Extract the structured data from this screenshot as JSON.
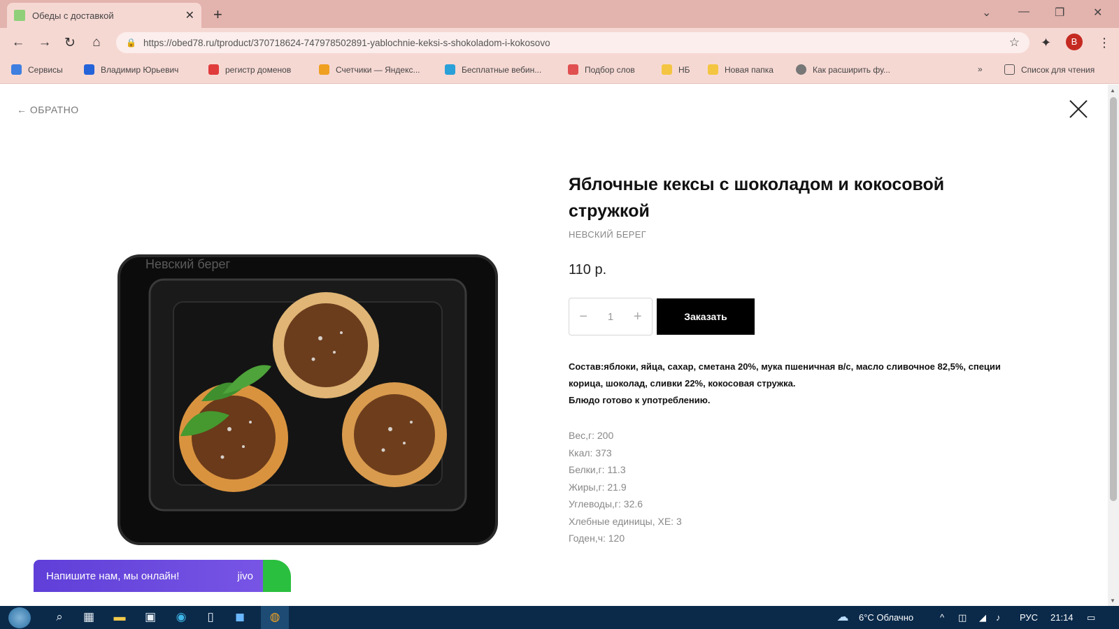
{
  "browser": {
    "tab_title": "Обеды с доставкой",
    "tab_close": "✕",
    "new_tab": "+",
    "url": "https://obed78.ru/tproduct/370718624-747978502891-yablochnie-keksi-s-shokoladom-i-kokosovo",
    "bookmarks": [
      {
        "label": "Сервисы",
        "color": "#3f7fe0"
      },
      {
        "label": "Владимир Юрьевич",
        "color": "#2563d9"
      },
      {
        "label": "регистр доменов",
        "color": "#e03c3c"
      },
      {
        "label": "Счетчики — Яндекс...",
        "color": "#f0a020"
      },
      {
        "label": "Бесплатные вебин...",
        "color": "#2aa0d8"
      },
      {
        "label": "Подбор слов",
        "color": "#e05050"
      },
      {
        "label": "НБ",
        "color": "#f4c542"
      },
      {
        "label": "Новая папка",
        "color": "#f4c542"
      },
      {
        "label": "Как расширить фу...",
        "color": "#777777"
      }
    ],
    "more_bookmarks": "»",
    "reading_list": "Список для чтения",
    "profile_initial": "В"
  },
  "page": {
    "back_label": "← ОБРАТНО",
    "title": "Яблочные кексы с шоколадом и кокосовой стружкой",
    "brand": "НЕВСКИЙ БЕРЕГ",
    "price": "110 р.",
    "quantity": {
      "minus": "−",
      "value": "1",
      "plus": "+"
    },
    "order_button": "Заказать",
    "description_lines": [
      "Состав:яблоки, яйца, сахар, сметана 20%, мука пшеничная в/с, масло сливочное 82,5%, специи корица, шоколад, сливки 22%, кокосовая стружка.",
      "Блюдо готово к употреблению."
    ],
    "nutrition": [
      "Вес,г: 200",
      "Ккал: 373",
      "Белки,г: 11.3",
      "Жиры,г: 21.9",
      "Углеводы,г: 32.6",
      "Хлебные единицы, ХЕ: 3",
      "Годен,ч: 120"
    ],
    "image_watermark": "Невский берег"
  },
  "chat": {
    "label": "Напишите нам, мы онлайн!",
    "brand": "jivo"
  },
  "taskbar": {
    "weather": "6°C  Облачно",
    "language": "РУС",
    "time": "21:14"
  },
  "colors": {
    "chrome": "#e3b3ad",
    "toolbar": "#f6d8d3",
    "order_button": "#000000",
    "chat_accent": "#6a4ade",
    "taskbar": "#0b2a4a"
  }
}
